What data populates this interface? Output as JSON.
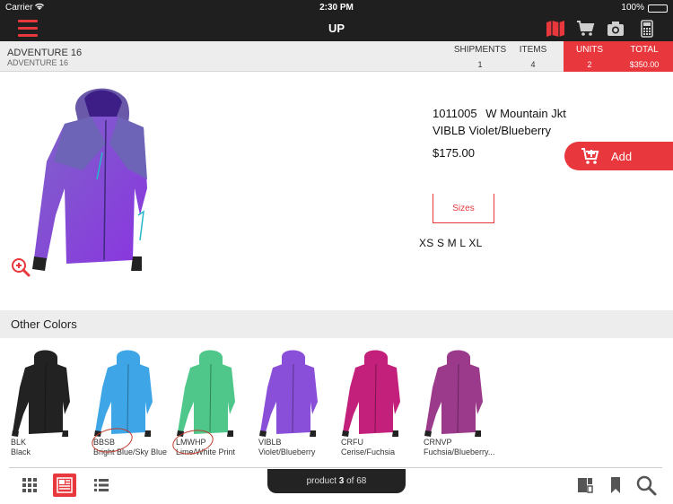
{
  "status_bar": {
    "carrier": "Carrier",
    "time": "2:30 PM",
    "battery": "100%"
  },
  "nav": {
    "title": "UP",
    "icons": [
      "menu-icon",
      "catalog-map-icon",
      "cart-icon",
      "camera-icon",
      "calculator-icon"
    ]
  },
  "account": {
    "name": "ADVENTURE 16",
    "subname": "ADVENTURE 16",
    "stats": {
      "shipments_label": "SHIPMENTS",
      "shipments_value": "1",
      "items_label": "ITEMS",
      "items_value": "4",
      "units_label": "UNITS",
      "units_value": "2",
      "total_label": "TOTAL",
      "total_value": "$350.00"
    }
  },
  "product": {
    "code": "1011005",
    "name": "W Mountain Jkt",
    "color": "VIBLB Violet/Blueberry",
    "price": "$175.00",
    "add_label": "Add",
    "sizes_label": "Sizes",
    "sizes": "XS S M L XL"
  },
  "other_colors": {
    "title": "Other Colors",
    "items": [
      {
        "code": "BLK",
        "desc": "Black",
        "color": "#222222"
      },
      {
        "code": "BBSB",
        "desc": "Bright Blue/Sky Blue",
        "color": "#3ea6e6"
      },
      {
        "code": "LMWHP",
        "desc": "Lime/White Print",
        "color": "#4fc78a"
      },
      {
        "code": "VIBLB",
        "desc": "Violet/Blueberry",
        "color": "#8a4fd8"
      },
      {
        "code": "CRFU",
        "desc": "Cerise/Fuchsia",
        "color": "#c2207a"
      },
      {
        "code": "CRNVP",
        "desc": "Fuchsia/Blueberry...",
        "color": "#9b3a8a"
      }
    ]
  },
  "pager": {
    "prefix": "product",
    "current": "3",
    "of_label": "of",
    "total": "68"
  },
  "toolbar": {
    "left": [
      "grid-view-icon",
      "detail-view-icon",
      "list-view-icon"
    ],
    "right": [
      "compare-icon",
      "bookmark-icon",
      "search-icon"
    ]
  },
  "colors": {
    "accent": "#e8383d",
    "dark": "#1f1f1f",
    "header_bg": "#ededed"
  }
}
